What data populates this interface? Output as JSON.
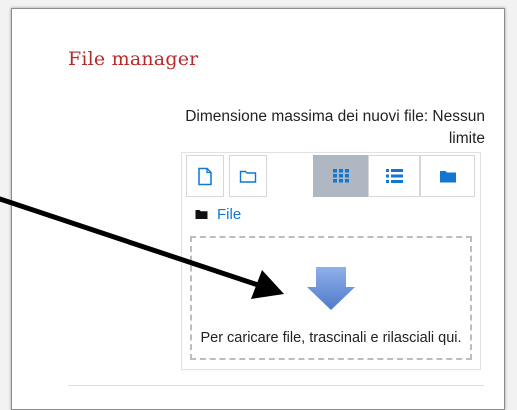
{
  "panel": {
    "title": "File manager",
    "max_size_text": "Dimensione massima dei nuovi file: Nessun limite"
  },
  "filemanager": {
    "toolbar": [
      {
        "name": "add-file-button",
        "icon": "file-icon"
      },
      {
        "name": "create-folder-button",
        "icon": "folder-outline-icon"
      },
      {
        "name": "view-icons-button",
        "icon": "grid-icon",
        "active": true
      },
      {
        "name": "view-list-button",
        "icon": "list-icon"
      },
      {
        "name": "view-tree-button",
        "icon": "folder-filled-icon"
      }
    ],
    "breadcrumb": {
      "label": "File",
      "icon": "folder-filled-icon"
    },
    "dropzone": {
      "text": "Per caricare file, trascinali e rilasciali qui.",
      "icon": "down-arrow-icon"
    }
  },
  "annotation": {
    "icon": "pointer-arrow"
  },
  "colors": {
    "title": "#b52b2b",
    "link": "#1177d1",
    "active_view": "#aeb7c2",
    "arrow": "#5b86d4"
  }
}
